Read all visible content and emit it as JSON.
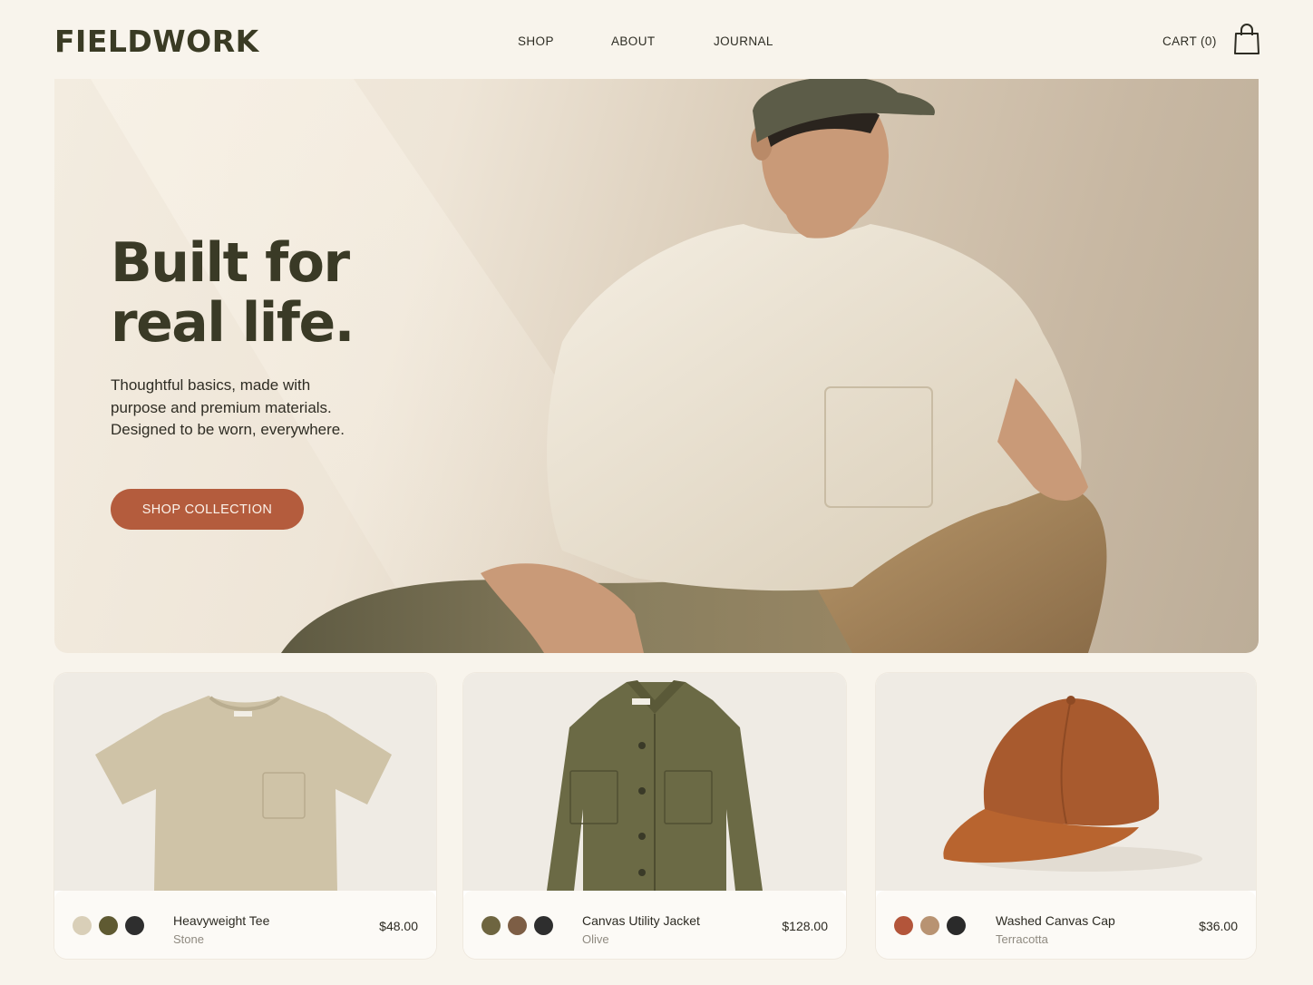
{
  "brand": {
    "name": "FIELDWORK"
  },
  "nav": {
    "shop": "SHOP",
    "about": "ABOUT",
    "journal": "JOURNAL"
  },
  "cart": {
    "label": "CART (0)",
    "icon": "shopping-bag-icon"
  },
  "hero": {
    "title_line1": "Built for",
    "title_line2": "real life.",
    "subtitle_line1": "Thoughtful basics, made with",
    "subtitle_line2": "purpose and premium materials.",
    "subtitle_line3": "Designed to be worn, everywhere.",
    "cta": "SHOP COLLECTION"
  },
  "products": [
    {
      "name": "Heavyweight Tee",
      "color": "Stone",
      "price": "$48.00",
      "swatches": [
        "#d9cfb8",
        "#5f5a32",
        "#2e2e2e"
      ]
    },
    {
      "name": "Canvas Utility Jacket",
      "color": "Olive",
      "price": "$128.00",
      "swatches": [
        "#6e6540",
        "#7d5e45",
        "#2e2e2e"
      ]
    },
    {
      "name": "Washed Canvas Cap",
      "color": "Terracotta",
      "price": "$36.00",
      "swatches": [
        "#b3553a",
        "#b89372",
        "#2a2a2a"
      ]
    }
  ],
  "colors": {
    "accent": "#b45c3d",
    "background": "#f8f4ec",
    "brand_text": "#3a3b24"
  }
}
